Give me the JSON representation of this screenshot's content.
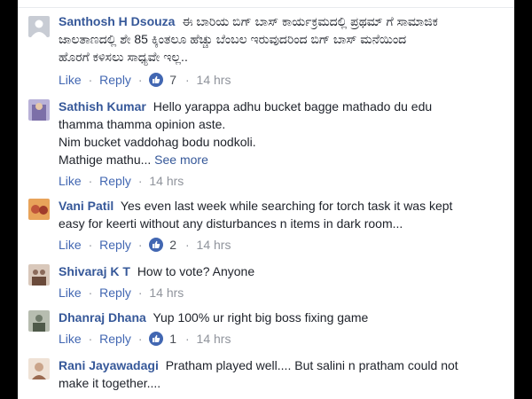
{
  "action_labels": {
    "like": "Like",
    "reply": "Reply",
    "separator": "·"
  },
  "see_more_label": "See more",
  "comments": [
    {
      "name": "Santhosh H Dsouza",
      "lines": [
        "ಈ ಬಾರಿಯ ಬಿಗ್ ಬಾಸ್ ಕಾರ್ಯಕ್ರಮದಲ್ಲಿ ಪ್ರಥಮ್ ಗೆ ಸಾಮಾಜಿಕ",
        "ಜಾಲತಾಣದಲ್ಲಿ ಶೇ 85 ಕ್ಕಿಂತಲೂ ಹೆಚ್ಚು ಬೆಂಬಲ ಇರುವುದರಿಂದ ಬಿಗ್ ಬಾಸ್ ಮನೆಯಿಂದ",
        "ಹೊರಗೆ ಕಳಿಸಲು ಸಾಧ್ಯವೇ ಇಲ್ಲ.."
      ],
      "reactions": "7",
      "time": "14 hrs",
      "avatar_color": "#c8ccd4"
    },
    {
      "name": "Sathish Kumar",
      "lines": [
        "Hello yarappa adhu bucket bagge mathado du edu",
        "thamma thamma opinion aste.",
        "Nim bucket vaddohag bodu nodkoli.",
        "Mathige mathu..."
      ],
      "reactions": "",
      "time": "14 hrs",
      "avatar_color": "#7c6fa8"
    },
    {
      "name": "Vani Patil",
      "lines": [
        "Yes even last week while searching for torch task it was kept",
        "easy for keerti without any disturbances n items in dark room..."
      ],
      "reactions": "2",
      "time": "14 hrs",
      "avatar_color": "#c0553a"
    },
    {
      "name": "Shivaraj K T",
      "lines": [
        "How to vote? Anyone"
      ],
      "reactions": "",
      "time": "14 hrs",
      "avatar_color": "#8a6a5a"
    },
    {
      "name": "Dhanraj Dhana",
      "lines": [
        "Yup 100% ur right big boss fixing game"
      ],
      "reactions": "1",
      "time": "14 hrs",
      "avatar_color": "#6f7a6a"
    },
    {
      "name": "Rani Jayawadagi",
      "lines": [
        "Pratham played well.... But salini n pratham could not",
        "make it together...."
      ],
      "reactions": "",
      "time": "",
      "avatar_color": "#caa48a"
    }
  ]
}
